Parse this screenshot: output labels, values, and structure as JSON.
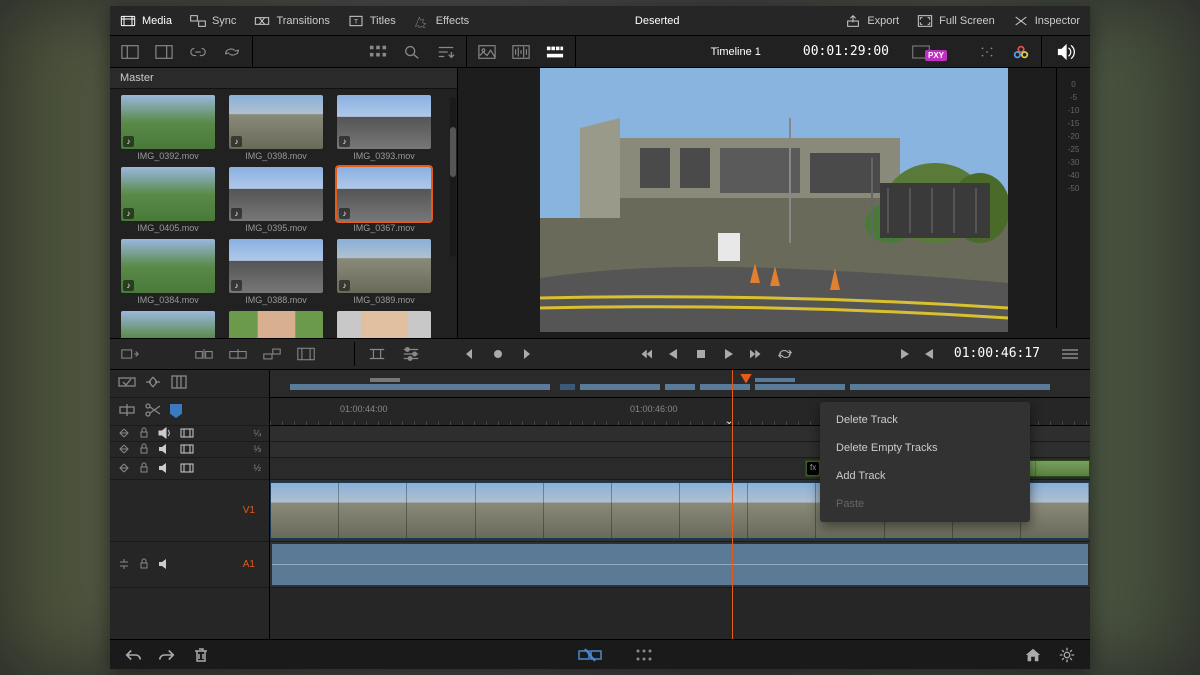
{
  "topbar": {
    "media": "Media",
    "sync": "Sync",
    "transitions": "Transitions",
    "titles": "Titles",
    "effects": "Effects",
    "project": "Deserted",
    "export": "Export",
    "fullscreen": "Full Screen",
    "inspector": "Inspector"
  },
  "toolbar": {
    "timeline_name": "Timeline 1",
    "viewer_tc": "00:01:29:00",
    "pxy": "PXY"
  },
  "media": {
    "master": "Master",
    "items": [
      {
        "name": "IMG_0392.mov",
        "cls": "green"
      },
      {
        "name": "IMG_0398.mov",
        "cls": "bldg"
      },
      {
        "name": "IMG_0393.mov",
        "cls": "road"
      },
      {
        "name": "IMG_0405.mov",
        "cls": "green"
      },
      {
        "name": "IMG_0395.mov",
        "cls": "road"
      },
      {
        "name": "IMG_0367.mov",
        "cls": "road",
        "selected": true
      },
      {
        "name": "IMG_0384.mov",
        "cls": "green"
      },
      {
        "name": "IMG_0388.mov",
        "cls": "road"
      },
      {
        "name": "IMG_0389.mov",
        "cls": "bldg"
      },
      {
        "name": "",
        "cls": "green"
      },
      {
        "name": "",
        "cls": "face1"
      },
      {
        "name": "",
        "cls": "face2"
      }
    ]
  },
  "meter": {
    "ticks": [
      "0",
      "-5",
      "-10",
      "-15",
      "-20",
      "-25",
      "-30",
      "-40",
      "-50"
    ]
  },
  "midbar": {
    "tc": "01:00:46:17"
  },
  "ruler": {
    "t1": "01:00:44:00",
    "t2": "01:00:46:00"
  },
  "tracks": {
    "v1": "V1",
    "a1": "A1",
    "fx": "fx"
  },
  "context_menu": {
    "delete_track": "Delete Track",
    "delete_empty": "Delete Empty Tracks",
    "add_track": "Add Track",
    "paste": "Paste"
  }
}
